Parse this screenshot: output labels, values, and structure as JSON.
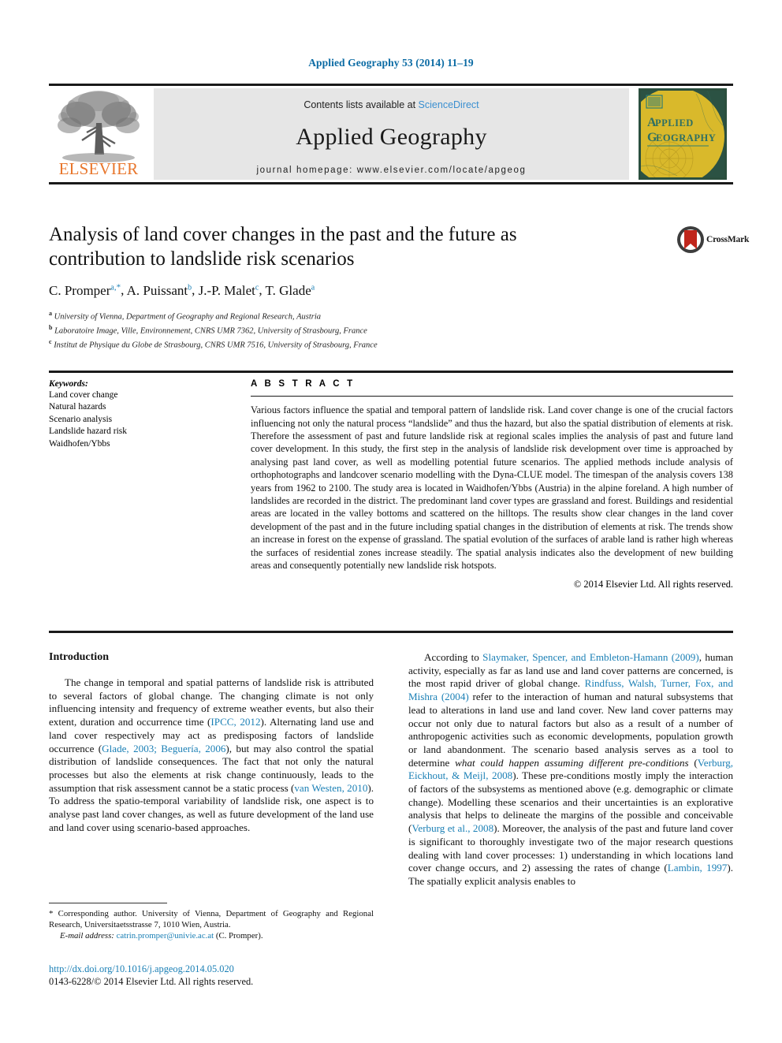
{
  "running_head": "Applied Geography 53 (2014) 11–19",
  "masthead": {
    "contents_prefix": "Contents lists available at",
    "sciencedirect": "ScienceDirect",
    "journal_name": "Applied Geography",
    "homepage": "journal homepage: www.elsevier.com/locate/apgeog",
    "publisher": "ELSEVIER",
    "cover_line1": "APPLIED",
    "cover_line2": "GEOGRAPHY",
    "colors": {
      "link": "#3a8fd0",
      "elsevier_orange": "#E8762C",
      "cover_green": "#2b4f3e",
      "cover_gold": "#d8b52a",
      "cover_teal": "#2e7d72"
    }
  },
  "article": {
    "title": "Analysis of land cover changes in the past and the future as contribution to landslide risk scenarios",
    "authors": [
      {
        "name": "C. Promper",
        "sup": "a",
        "star": true
      },
      {
        "name": "A. Puissant",
        "sup": "b",
        "star": false
      },
      {
        "name": "J.-P. Malet",
        "sup": "c",
        "star": false
      },
      {
        "name": "T. Glade",
        "sup": "a",
        "star": false
      }
    ],
    "affiliations": [
      {
        "mark": "a",
        "text": "University of Vienna, Department of Geography and Regional Research, Austria"
      },
      {
        "mark": "b",
        "text": "Laboratoire Image, Ville, Environnement, CNRS UMR 7362, University of Strasbourg, France"
      },
      {
        "mark": "c",
        "text": "Institut de Physique du Globe de Strasbourg, CNRS UMR 7516, University of Strasbourg, France"
      }
    ],
    "crossmark_label": "CrossMark"
  },
  "keywords": {
    "heading": "Keywords:",
    "items": [
      "Land cover change",
      "Natural hazards",
      "Scenario analysis",
      "Landslide hazard risk",
      "Waidhofen/Ybbs"
    ]
  },
  "abstract": {
    "heading": "A B S T R A C T",
    "text": "Various factors influence the spatial and temporal pattern of landslide risk. Land cover change is one of the crucial factors influencing not only the natural process “landslide” and thus the hazard, but also the spatial distribution of elements at risk. Therefore the assessment of past and future landslide risk at regional scales implies the analysis of past and future land cover development. In this study, the first step in the analysis of landslide risk development over time is approached by analysing past land cover, as well as modelling potential future scenarios. The applied methods include analysis of orthophotographs and landcover scenario modelling with the Dyna-CLUE model. The timespan of the analysis covers 138 years from 1962 to 2100. The study area is located in Waidhofen/Ybbs (Austria) in the alpine foreland. A high number of landslides are recorded in the district. The predominant land cover types are grassland and forest. Buildings and residential areas are located in the valley bottoms and scattered on the hilltops. The results show clear changes in the land cover development of the past and in the future including spatial changes in the distribution of elements at risk. The trends show an increase in forest on the expense of grassland. The spatial evolution of the surfaces of arable land is rather high whereas the surfaces of residential zones increase steadily. The spatial analysis indicates also the development of new building areas and consequently potentially new landslide risk hotspots.",
    "copyright": "© 2014 Elsevier Ltd. All rights reserved."
  },
  "introduction": {
    "heading": "Introduction",
    "left_paragraph_parts": [
      {
        "t": "The change in temporal and spatial patterns of landslide risk is attributed to several factors of global change. The changing climate is not only influencing intensity and frequency of extreme weather events, but also their extent, duration and occurrence time (",
        "style": "plain"
      },
      {
        "t": "IPCC, 2012",
        "style": "ref"
      },
      {
        "t": "). Alternating land use and land cover respectively may act as predisposing factors of landslide occurrence (",
        "style": "plain"
      },
      {
        "t": "Glade, 2003; Beguería, 2006",
        "style": "ref"
      },
      {
        "t": "), but may also control the spatial distribution of landslide consequences. The fact that not only the natural processes but also the elements at risk change continuously, leads to the assumption that risk assessment cannot be a static process (",
        "style": "plain"
      },
      {
        "t": "van Westen, 2010",
        "style": "ref"
      },
      {
        "t": "). To address the spatio-temporal variability of landslide risk, one aspect is to analyse past land cover changes, as well as future development of the land use and land cover using scenario-based approaches.",
        "style": "plain"
      }
    ],
    "right_paragraph_parts": [
      {
        "t": "According to ",
        "style": "plain"
      },
      {
        "t": "Slaymaker, Spencer, and Embleton-Hamann (2009)",
        "style": "ref"
      },
      {
        "t": ", human activity, especially as far as land use and land cover patterns are concerned, is the most rapid driver of global change. ",
        "style": "plain"
      },
      {
        "t": "Rindfuss, Walsh, Turner, Fox, and Mishra (2004)",
        "style": "ref"
      },
      {
        "t": " refer to the interaction of human and natural subsystems that lead to alterations in land use and land cover. New land cover patterns may occur not only due to natural factors but also as a result of a number of anthropogenic activities such as economic developments, population growth or land abandonment. The scenario based analysis serves as a tool to determine ",
        "style": "plain"
      },
      {
        "t": "what could happen assuming different pre-conditions",
        "style": "italic"
      },
      {
        "t": " (",
        "style": "plain"
      },
      {
        "t": "Verburg, Eickhout, & Meijl, 2008",
        "style": "ref"
      },
      {
        "t": "). These pre-conditions mostly imply the interaction of factors of the subsystems as mentioned above (e.g. demographic or climate change). Modelling these scenarios and their uncertainties is an explorative analysis that helps to delineate the margins of the possible and conceivable (",
        "style": "plain"
      },
      {
        "t": "Verburg et al., 2008",
        "style": "ref"
      },
      {
        "t": "). Moreover, the analysis of the past and future land cover is significant to thoroughly investigate two of the major research questions dealing with land cover processes: 1) understanding in which locations land cover change occurs, and 2) assessing the rates of change (",
        "style": "plain"
      },
      {
        "t": "Lambin, 1997",
        "style": "ref"
      },
      {
        "t": "). The spatially explicit analysis enables to",
        "style": "plain"
      }
    ]
  },
  "footnote": {
    "corresponding": "* Corresponding author. University of Vienna, Department of Geography and Regional Research, Universitaetsstrasse 7, 1010 Wien, Austria.",
    "email_label": "E-mail address:",
    "email": "catrin.promper@univie.ac.at",
    "email_suffix": "(C. Promper)."
  },
  "imprint": {
    "doi": "http://dx.doi.org/10.1016/j.apgeog.2014.05.020",
    "issn_line": "0143-6228/© 2014 Elsevier Ltd. All rights reserved."
  }
}
